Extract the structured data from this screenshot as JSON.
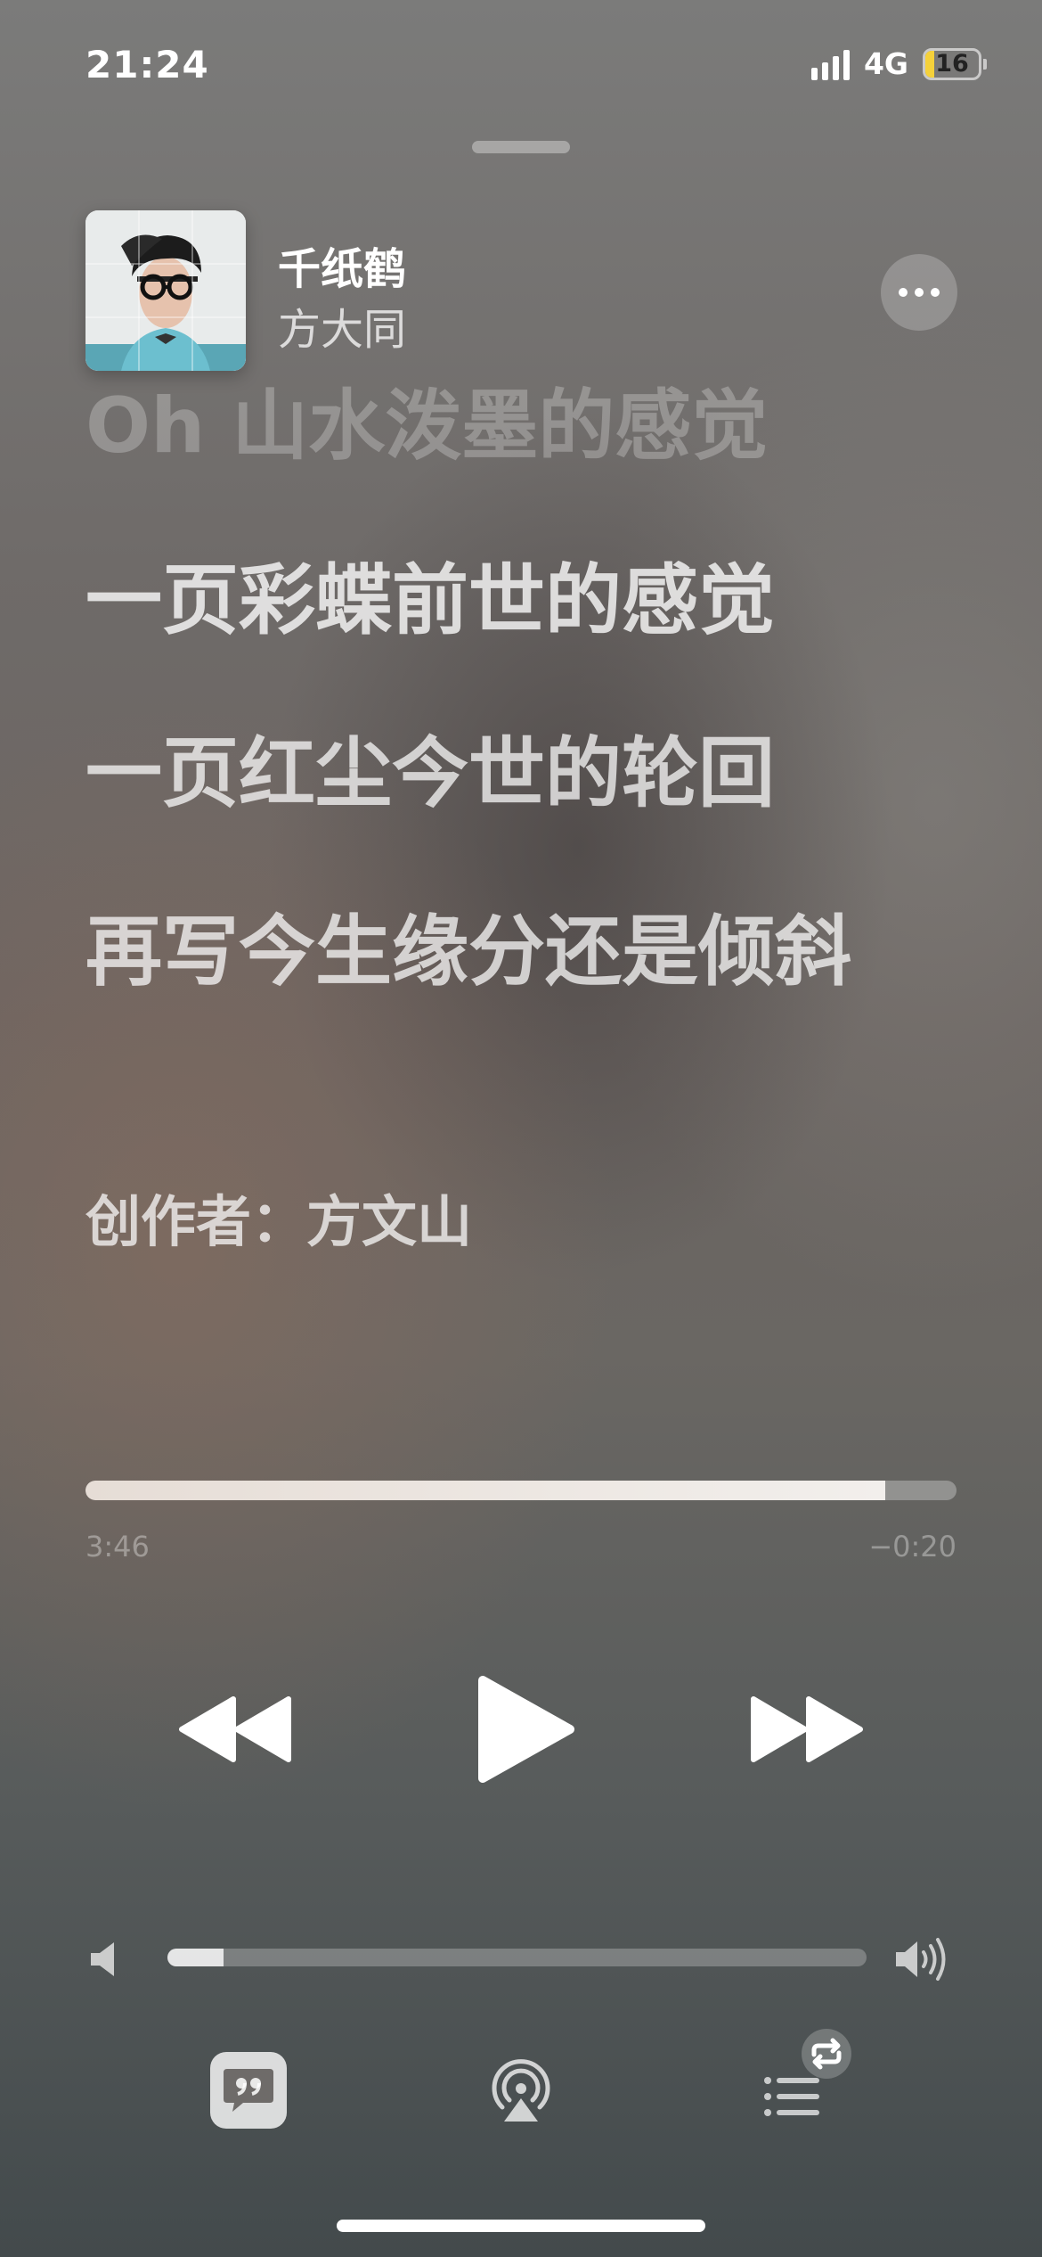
{
  "status_bar": {
    "time": "21:24",
    "network": "4G",
    "battery_level": "16"
  },
  "now_playing": {
    "title": "千纸鹤",
    "artist": "方大同",
    "album_art": "album-cover-portrait"
  },
  "lyrics": {
    "previous_line": "Oh 山水泼墨的感觉",
    "lines": [
      "一页彩蝶前世的感觉",
      "一页红尘今世的轮回",
      "再写今生缘分还是倾斜"
    ],
    "credit": "创作者：方文山"
  },
  "playback": {
    "elapsed": "3:46",
    "remaining": "−0:20",
    "progress_fraction": 0.918
  },
  "volume": {
    "level_fraction": 0.08
  },
  "icons": {
    "more": "ellipsis-icon",
    "rewind": "rewind-icon",
    "play": "play-icon",
    "forward": "fast-forward-icon",
    "volume_min": "speaker-icon",
    "volume_max": "speaker-wave-icon",
    "lyrics": "lyrics-quote-icon",
    "airplay": "airplay-icon",
    "queue": "queue-list-icon",
    "repeat": "repeat-icon"
  },
  "colors": {
    "battery_fill": "#f5d13a",
    "progress_fill": "#efe8e2"
  }
}
